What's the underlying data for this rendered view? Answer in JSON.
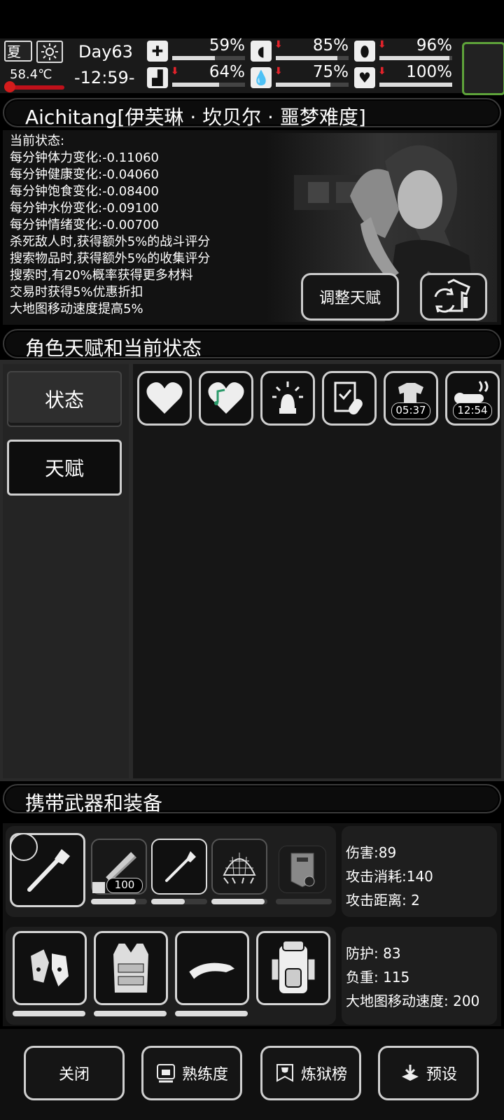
{
  "status": {
    "season": "夏",
    "temperature": "58.4℃",
    "day": "Day63",
    "time": "-12:59-",
    "stats": [
      {
        "icon": "medkit-icon",
        "value": "59%",
        "fill": 0.59,
        "down": false
      },
      {
        "icon": "stomach-icon",
        "value": "85%",
        "fill": 0.85,
        "down": true
      },
      {
        "icon": "bladder-icon",
        "value": "96%",
        "fill": 0.96,
        "down": true
      },
      {
        "icon": "boot-icon",
        "value": "64%",
        "fill": 0.64,
        "down": true
      },
      {
        "icon": "water-drop-icon",
        "value": "75%",
        "fill": 0.75,
        "down": true
      },
      {
        "icon": "heart-icon",
        "value": "100%",
        "fill": 1.0,
        "down": true
      }
    ]
  },
  "character": {
    "title": "Aichitang[伊芙琳 · 坎贝尔 · 噩梦难度]",
    "info": [
      "当前状态:",
      "每分钟体力变化:-0.11060",
      "每分钟健康变化:-0.04060",
      "每分钟饱食变化:-0.08400",
      "每分钟水份变化:-0.09100",
      "每分钟情绪变化:-0.00700",
      "杀死敌人时,获得额外5%的战斗评分",
      "搜索物品时,获得额外5%的收集评分",
      "搜索时,有20%概率获得更多材料",
      "交易时获得5%优惠折扣",
      "大地图移动速度提高5%"
    ],
    "adjust_talent_label": "调整天赋"
  },
  "talent_section": {
    "title": "角色天赋和当前状态",
    "tab_status": "状态",
    "tab_talent": "天赋",
    "state_icons": [
      {
        "icon": "heart-icon",
        "timer": ""
      },
      {
        "icon": "music-heart-icon",
        "timer": ""
      },
      {
        "icon": "alarm-light-icon",
        "timer": ""
      },
      {
        "icon": "medicine-checklist-icon",
        "timer": ""
      },
      {
        "icon": "dirty-clothes-icon",
        "timer": "05:37"
      },
      {
        "icon": "thermometer-heat-icon",
        "timer": "12:54"
      }
    ]
  },
  "equipment": {
    "title": "携带武器和装备",
    "ammo_count": "100",
    "weapon_stats": [
      "伤害:89",
      "攻击消耗:140",
      "攻击距离: 2"
    ],
    "armor_stats": [
      "防护: 83",
      "负重: 115",
      "大地图移动速度: 200"
    ]
  },
  "bottom": {
    "close": "关闭",
    "proficiency": "熟练度",
    "ranking": "炼狱榜",
    "preset": "预设"
  }
}
